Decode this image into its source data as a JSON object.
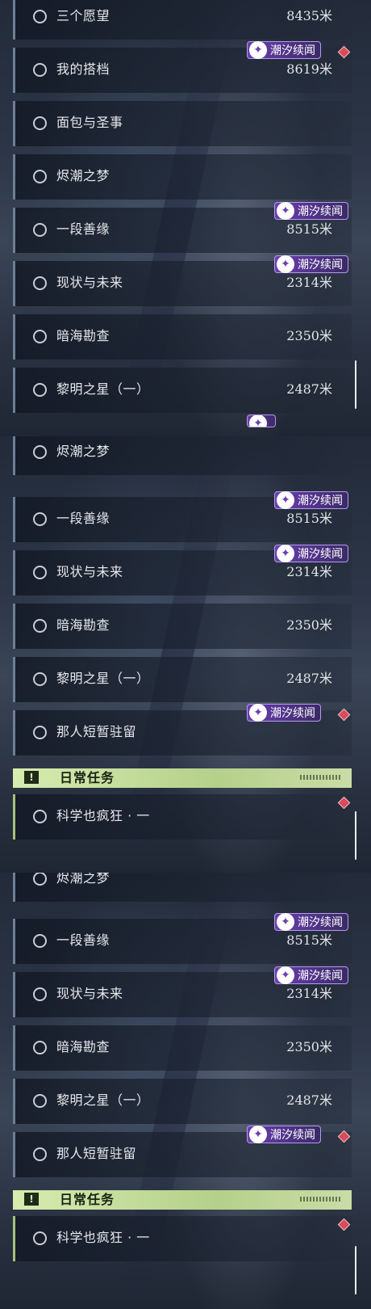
{
  "badge_text": "潮汐续闻",
  "daily_header": "日常任务",
  "colors": {
    "badge": "#6a3fb0",
    "diamond": "#d94a5a",
    "daily_accent": "#b5d08a"
  },
  "panel1": {
    "rows": [
      {
        "title": "三个愿望",
        "distance": "8435米"
      },
      {
        "title": "我的搭档",
        "distance": "8619米"
      },
      {
        "title": "面包与圣事",
        "distance": ""
      },
      {
        "title": "烬潮之梦",
        "distance": ""
      },
      {
        "title": "一段善缘",
        "distance": "8515米"
      },
      {
        "title": "现状与未来",
        "distance": "2314米"
      },
      {
        "title": "暗海勘查",
        "distance": "2350米"
      },
      {
        "title": "黎明之星（一）",
        "distance": "2487米"
      }
    ]
  },
  "panel2": {
    "rows": [
      {
        "title": "烬潮之梦",
        "distance": ""
      },
      {
        "title": "一段善缘",
        "distance": "8515米"
      },
      {
        "title": "现状与未来",
        "distance": "2314米"
      },
      {
        "title": "暗海勘查",
        "distance": "2350米"
      },
      {
        "title": "黎明之星（一）",
        "distance": "2487米"
      },
      {
        "title": "那人短暂驻留",
        "distance": ""
      }
    ],
    "daily": {
      "title": "科学也疯狂 · 一"
    }
  },
  "panel3": {
    "rows": [
      {
        "title": "烬潮之梦",
        "distance": ""
      },
      {
        "title": "一段善缘",
        "distance": "8515米"
      },
      {
        "title": "现状与未来",
        "distance": "2314米"
      },
      {
        "title": "暗海勘查",
        "distance": "2350米"
      },
      {
        "title": "黎明之星（一）",
        "distance": "2487米"
      },
      {
        "title": "那人短暂驻留",
        "distance": ""
      }
    ],
    "daily": {
      "title": "科学也疯狂 · 一"
    }
  }
}
